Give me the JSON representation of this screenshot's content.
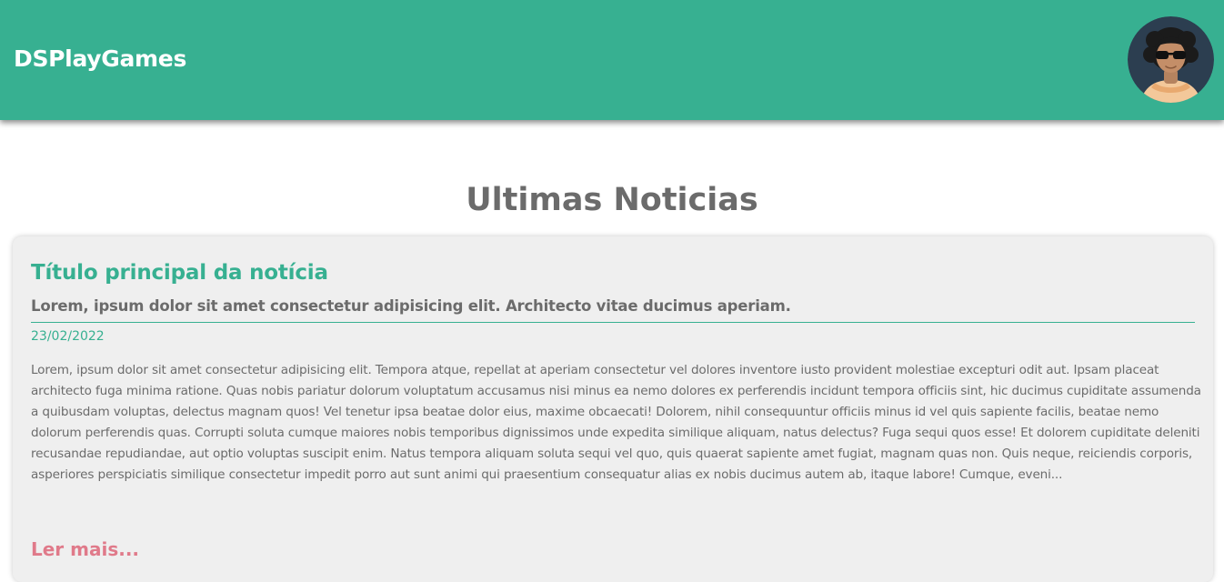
{
  "header": {
    "brand": "DSPlayGames",
    "avatar_icon": "user-avatar-sunglasses",
    "color": "#37b091"
  },
  "main": {
    "section_title": "Ultimas Noticias",
    "news": [
      {
        "title": "Título principal da notícia",
        "subtitle": "Lorem, ipsum dolor sit amet consectetur adipisicing elit. Architecto vitae ducimus aperiam.",
        "date": "23/02/2022",
        "body": "Lorem, ipsum dolor sit amet consectetur adipisicing elit. Tempora atque, repellat at aperiam consectetur vel dolores inventore iusto provident molestiae excepturi odit aut. Ipsam placeat architecto fuga minima ratione. Quas nobis pariatur dolorum voluptatum accusamus nisi minus ea nemo dolores ex perferendis incidunt tempora officiis sint, hic ducimus cupiditate assumenda a quibusdam voluptas, delectus magnam quos! Vel tenetur ipsa beatae dolor eius, maxime obcaecati! Dolorem, nihil consequuntur officiis minus id vel quis sapiente facilis, beatae nemo dolorum perferendis quas. Corrupti soluta cumque maiores nobis temporibus dignissimos unde expedita similique aliquam, natus delectus? Fuga sequi quos esse! Et dolorem cupiditate deleniti recusandae repudiandae, aut optio voluptas suscipit enim. Natus tempora aliquam soluta sequi vel quo, quis quaerat sapiente amet fugiat, magnam quas non. Quis neque, reiciendis corporis, asperiores perspiciatis similique consectetur impedit porro aut sunt animi qui praesentium consequatur alias ex nobis ducimus autem ab, itaque labore! Cumque, eveni...",
        "read_more": "Ler mais..."
      }
    ]
  },
  "colors": {
    "accent": "#37b091",
    "text_gray": "#6b6b6b",
    "link_pink": "#e07a8a",
    "card_bg": "#efefef"
  }
}
